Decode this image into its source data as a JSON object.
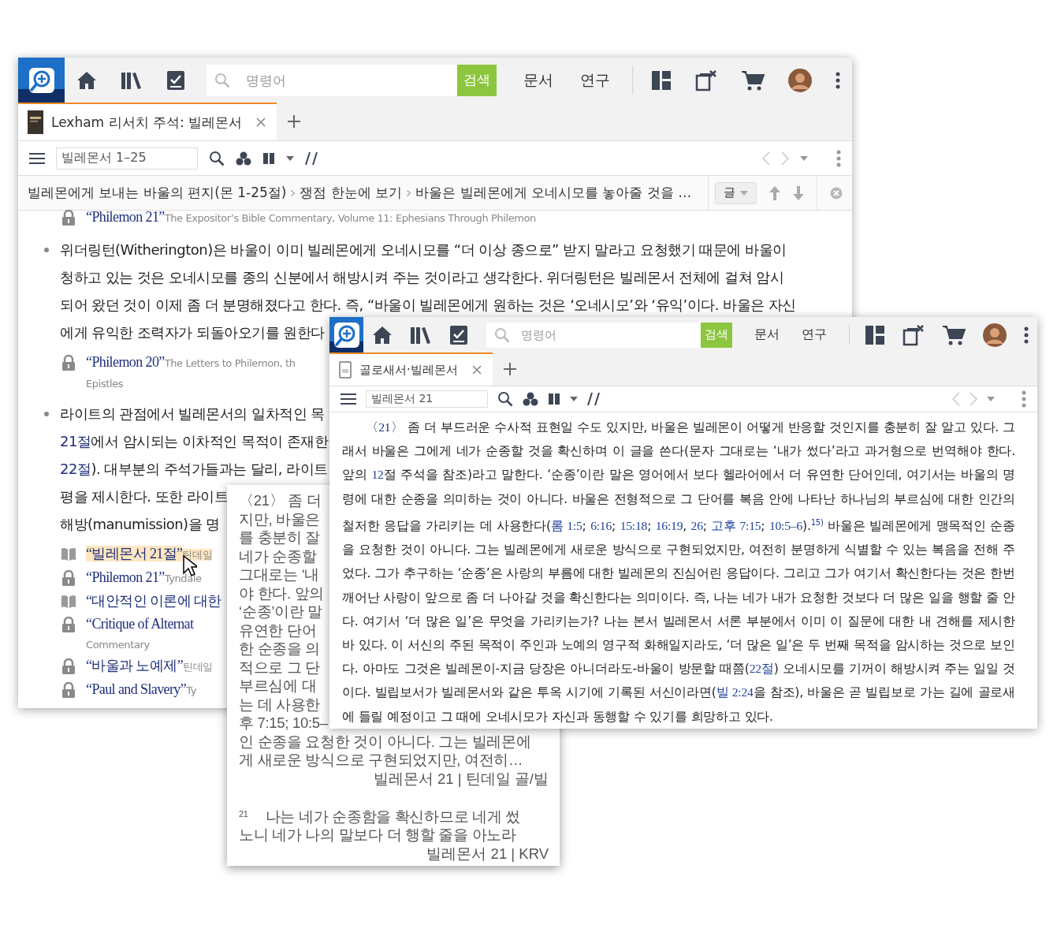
{
  "main_window": {
    "toolbar": {
      "search_placeholder": "명령어",
      "search_button": "검색",
      "menus": [
        "문서",
        "연구"
      ]
    },
    "tabs": [
      {
        "label": "Lexham 리서치 주석: 빌레몬서",
        "selected": true
      }
    ],
    "reference": "빌레몬서 1–25",
    "breadcrumb": [
      "빌레몬에게 보내는 바울의 편지(몬 1-25절)",
      "쟁점 한눈에 보기",
      "바울은 빌레몬에게 오네시모를 놓아줄 것을 …"
    ],
    "sort_button": "글",
    "top_ref": {
      "kind": "locked",
      "title": "“Philemon 21”",
      "source": "The Expositor’s Bible Commentary, Volume 11: Ephesians Through Philemon",
      "highlighted": false
    },
    "bullets": [
      {
        "lines": [
          "위더링턴(Witherington)은 바울이 이미 빌레몬에게 오네시모를 “더 이상 종으로” 받지 말라고 요청했기 때문에 바울이",
          "청하고 있는 것은 오네시모를 종의 신분에서 해방시켜 주는 것이라고 생각한다. 위더링턴은 빌레몬서 전체에 걸쳐 암시",
          "되어 왔던 것이 이제 좀 더 분명해졌다고 한다. 즉, “바울이 빌레몬에게 원하는 것은 ‘오네시모’와 ‘유익’이다. 바울은 자신",
          "에게 유익한 조력자가 되돌아오기를 원한다"
        ],
        "refs": [
          {
            "kind": "locked",
            "title": "“Philemon 20”",
            "source": "The Letters to Philemon, th",
            "source_cont": "Epistles",
            "highlighted": false
          }
        ]
      },
      {
        "lines": [
          "라이트의 관점에서 빌레몬서의 일차적인 목",
          [
            {
              "kind": "link",
              "text": "21절"
            },
            {
              "kind": "text",
              "text": "에서 암시되는 이차적인 목적이 존재한"
            }
          ],
          [
            {
              "kind": "link",
              "text": "22절"
            },
            {
              "kind": "text",
              "text": "). 대부분의 주석가들과는 달리, 라이트"
            }
          ],
          "평을 제시한다. 또한 라이트",
          "해방(manumission)을 명"
        ],
        "refs": [
          {
            "kind": "owned",
            "title": "“빌레몬서 21절”",
            "source": "틴데일",
            "highlighted": true
          },
          {
            "kind": "locked",
            "title": "“Philemon 21”",
            "source": "Tyndale",
            "highlighted": false
          },
          {
            "kind": "owned",
            "title": "“대안적인 이론에 대한",
            "highlighted": false
          },
          {
            "kind": "locked",
            "title": "“Critique of Alternat",
            "source_cont": "Commentary",
            "highlighted": false
          },
          {
            "kind": "locked",
            "title": "“바울과 노예제”",
            "source": "틴데일",
            "highlighted": false
          },
          {
            "kind": "locked",
            "title": "“Paul and Slavery”",
            "source": "Ty",
            "highlighted": false
          }
        ]
      }
    ]
  },
  "popup": {
    "entries": [
      {
        "lines": [
          "〈21〉 좀 더",
          "지만, 바울은",
          "를 충분히 잘",
          "네가 순종할",
          "그대로는 ‘내",
          "야 한다. 앞의",
          "‘순종’이란 말",
          "유연한 단어",
          "한 순종을 의",
          "적으로 그 단",
          "부르심에 대",
          "는 데 사용한",
          "후 7:15; 10:5–",
          "인 순종을 요청한 것이 아니다. 그는 빌레몬에",
          "게 새로운 방식으로 구현되었지만, 여전히…"
        ],
        "citation": "빌레몬서 21 | 틴데일 골/빌"
      },
      {
        "verse": "21",
        "lines": [
          "나는 네가 순종함을 확신하므로 네게 썼",
          "노니 네가 나의 말보다 더 행할 줄을 아노라"
        ],
        "citation": "빌레몬서 21 | KRV"
      }
    ]
  },
  "front_window": {
    "toolbar": {
      "search_placeholder": "명령어",
      "search_button": "검색",
      "menus": [
        "문서",
        "연구"
      ]
    },
    "tabs": [
      {
        "label": "골로새서·빌레몬서",
        "selected": true
      }
    ],
    "reference": "빌레몬서 21",
    "paragraph": [
      {
        "kind": "verse",
        "text": "〈21〉"
      },
      {
        "kind": "text",
        "text": " 좀 더 부드러운 수사적 표현일 수도 있지만, 바울은 빌레몬이 어떻게 반응할 것인지를 충분히 잘 알고 있다. 그래서 바울은 그에게 네가 순종할 것을 확신하며 이 글을 쓴다(문자 그대로는 ‘내가 썼다’라고 과거형으로 번역해야 한다. 앞의 "
      },
      {
        "kind": "link",
        "text": "12"
      },
      {
        "kind": "text",
        "text": "절 주석을 참조)라고 말한다. ‘순종’이란 말은 영어에서 보다 헬라어에서 더 유연한 단어인데, 여기서는 바울의 명령에 대한 순종을 의미하는 것이 아니다. 바울은 전형적으로 그 단어를 복음 안에 나타난 하나님의 부르심에 대한 인간의 철저한 응답을 가리키는 데 사용한다("
      },
      {
        "kind": "link",
        "text": "롬 1:5"
      },
      {
        "kind": "text",
        "text": "; "
      },
      {
        "kind": "link",
        "text": "6:16"
      },
      {
        "kind": "text",
        "text": "; "
      },
      {
        "kind": "link",
        "text": "15:18"
      },
      {
        "kind": "text",
        "text": "; "
      },
      {
        "kind": "link",
        "text": "16:19"
      },
      {
        "kind": "text",
        "text": ", "
      },
      {
        "kind": "link",
        "text": "26"
      },
      {
        "kind": "text",
        "text": "; "
      },
      {
        "kind": "link",
        "text": "고후 7:15"
      },
      {
        "kind": "text",
        "text": "; "
      },
      {
        "kind": "link",
        "text": "10:5–6"
      },
      {
        "kind": "text",
        "text": ")."
      },
      {
        "kind": "note",
        "text": "15)"
      },
      {
        "kind": "text",
        "text": " 바울은 빌레몬에게 맹목적인 순종을 요청한 것이 아니다. 그는 빌레몬에게 새로운 방식으로 구현되었지만, 여전히 분명하게 식별할 수 있는 복음을 전해 주었다. 그가 추구하는 ‘순종’은 사랑의 부름에 대한 빌레몬의 진심어린 응답이다. 그리고 그가 여기서 확신한다는 것은 한번 깨어난 사랑이 앞으로 좀 더 나아갈 것을 확신한다는 의미이다. 즉, 나는 네가 내가 요청한 것보다 더 많은 일을 행할 줄 안다. 여기서 ‘더 많은 일’은 무엇을 가리키는가? 나는 본서 빌레몬서 서론 부분에서 이미 이 질문에 대한 내 견해를 제시한 바 있다. 이 서신의 주된 목적이 주인과 노예의 영구적 화해일지라도, ‘더 많은 일’은 두 번째 목적을 암시하는 것으로 보인다. 아마도 그것은 빌레몬이-지금 당장은 아니더라도-바울이 방문할 때쯤("
      },
      {
        "kind": "link",
        "text": "22절"
      },
      {
        "kind": "text",
        "text": ") 오네시모를 기꺼이 해방시켜 주는 일일 것이다. 빌립보서가 빌레몬서와 같은 투옥 시기에 기록된 서신이라면("
      },
      {
        "kind": "link",
        "text": "빌 2:24"
      },
      {
        "kind": "text",
        "text": "을 참조), 바울은 곧 빌립보로 가는 길에 골로새에 들릴 예정이고 그 때에 오네시모가 자신과 동행할 수 있기를 희망하고 있다."
      }
    ]
  }
}
